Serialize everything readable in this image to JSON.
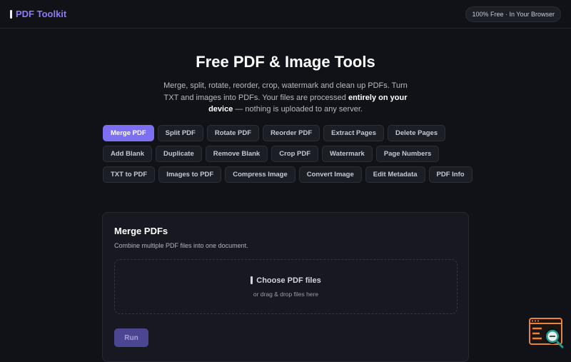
{
  "header": {
    "brand": "PDF Toolkit",
    "badge": "100% Free · In Your Browser"
  },
  "hero": {
    "title": "Free PDF & Image Tools",
    "subtitle_before": "Merge, split, rotate, reorder, crop, watermark and clean up PDFs. Turn TXT and images into PDFs. Your files are processed ",
    "subtitle_strong": "entirely on your device",
    "subtitle_after": " — nothing is uploaded to any server."
  },
  "tools": [
    "Merge PDF",
    "Split PDF",
    "Rotate PDF",
    "Reorder PDF",
    "Extract Pages",
    "Delete Pages",
    "Add Blank",
    "Duplicate",
    "Remove Blank",
    "Crop PDF",
    "Watermark",
    "Page Numbers",
    "TXT to PDF",
    "Images to PDF",
    "Compress Image",
    "Convert Image",
    "Edit Metadata",
    "PDF Info"
  ],
  "active_tool": "Merge PDF",
  "panel": {
    "title": "Merge PDFs",
    "description": "Combine multiple PDF files into one document.",
    "choose_label": "Choose PDF files",
    "drag_hint": "or drag & drop files here",
    "run_label": "Run"
  },
  "colors": {
    "accent": "#7c6ff2",
    "background": "#111217",
    "helper_orange": "#e8833a",
    "helper_teal": "#2a9d8f"
  }
}
